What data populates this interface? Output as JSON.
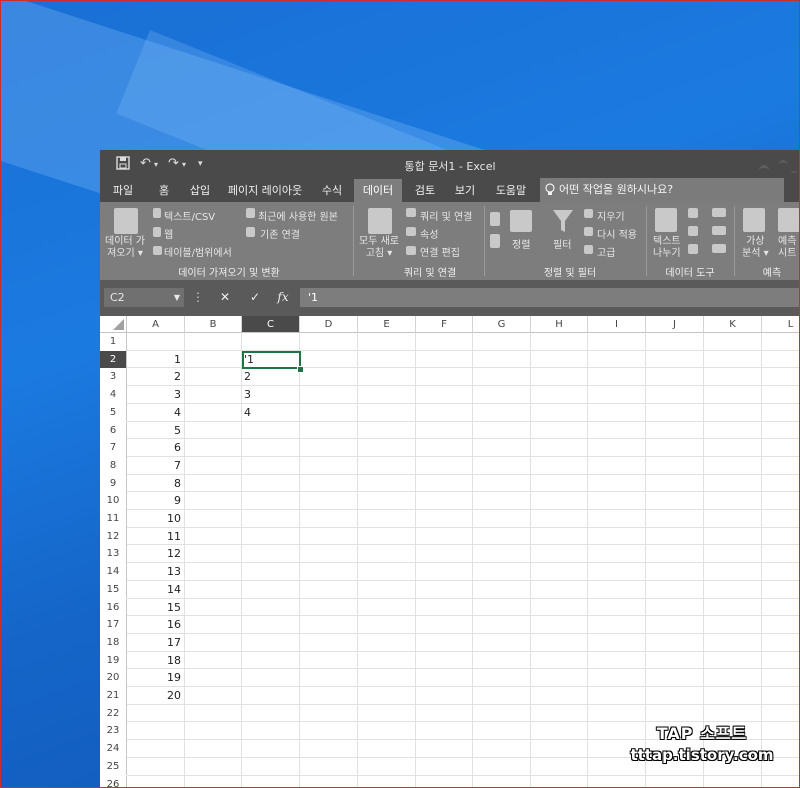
{
  "window": {
    "title": "통합 문서1 - Excel",
    "quick_access": {
      "save_icon": "save-icon",
      "undo": "↶",
      "redo": "↷",
      "customize": "▾"
    }
  },
  "tabs": [
    "파일",
    "홈",
    "삽입",
    "페이지 레이아웃",
    "수식",
    "데이터",
    "검토",
    "보기",
    "도움말"
  ],
  "active_tab": "데이터",
  "tell_me": "어떤 작업을 원하시나요?",
  "ribbon": {
    "get_data": "데이터 가\n져오기 ▾",
    "from_text": "텍스트/CSV",
    "from_web": "웹",
    "from_table": "테이블/범위에서",
    "recent_sources": "최근에 사용한 원본",
    "existing_conn": "기존 연결",
    "group1_label": "데이터 가져오기 및 변환",
    "refresh_all": "모두 새로\n고침 ▾",
    "queries_conn": "쿼리 및 연결",
    "properties": "속성",
    "edit_links": "연결 편집",
    "group2_label": "쿼리 및 연결",
    "sort": "정렬",
    "filter": "필터",
    "clear": "지우기",
    "reapply": "다시 적용",
    "advanced": "고급",
    "group3_label": "정렬 및 필터",
    "text_to_columns": "텍스트\n나누기",
    "group4_label": "데이터 도구",
    "what_if": "가상\n분석 ▾",
    "forecast": "예측\n시트",
    "group5_label": "예측"
  },
  "formula_bar": {
    "name_box": "C2",
    "cancel": "✕",
    "enter": "✓",
    "fx": "fx",
    "content": "'1"
  },
  "columns": [
    "A",
    "B",
    "C",
    "D",
    "E",
    "F",
    "G",
    "H",
    "I",
    "J",
    "K",
    "L"
  ],
  "rows": [
    "1",
    "2",
    "3",
    "4",
    "5",
    "6",
    "7",
    "8",
    "9",
    "10",
    "11",
    "12",
    "13",
    "14",
    "15",
    "16",
    "17",
    "18",
    "19",
    "20",
    "21",
    "22",
    "23",
    "24",
    "25",
    "26"
  ],
  "col_a_values": [
    "1",
    "2",
    "3",
    "4",
    "5",
    "6",
    "7",
    "8",
    "9",
    "10",
    "11",
    "12",
    "13",
    "14",
    "15",
    "16",
    "17",
    "18",
    "19",
    "20"
  ],
  "col_c_values": [
    "'1",
    "2",
    "3",
    "4"
  ],
  "watermark": {
    "line1": "TAP 소프트",
    "line2": "tttap.tistory.com"
  }
}
